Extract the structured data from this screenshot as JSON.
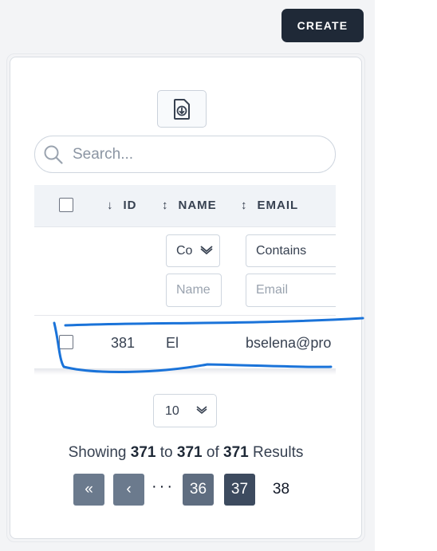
{
  "header": {
    "create_label": "CREATE"
  },
  "toolbar": {
    "export_icon": "file-download-icon"
  },
  "search": {
    "placeholder": "Search..."
  },
  "table": {
    "columns": [
      {
        "sort_icon": "↓",
        "label": "ID"
      },
      {
        "sort_icon": "↕",
        "label": "NAME"
      },
      {
        "sort_icon": "↕",
        "label": "EMAIL"
      }
    ],
    "filters": {
      "name_operator": "Co",
      "name_placeholder": "Name",
      "email_operator": "Contains",
      "email_placeholder": "Email"
    },
    "rows": [
      {
        "id": "381",
        "name": "El",
        "email": "bselena@pro"
      }
    ]
  },
  "pagination": {
    "page_size": "10",
    "showing_prefix": "Showing",
    "from": "371",
    "to_word": "to",
    "to": "371",
    "of_word": "of",
    "total": "371",
    "results_word": "Results",
    "ellipsis": "···",
    "pages": [
      "36",
      "37",
      "38"
    ],
    "current_page": "37",
    "first_icon": "«",
    "prev_icon": "‹"
  },
  "colors": {
    "primary_dark": "#1f2937",
    "annotation_blue": "#1a73d9",
    "page_button": "#5f6d80",
    "page_current": "#3d4b5f"
  }
}
